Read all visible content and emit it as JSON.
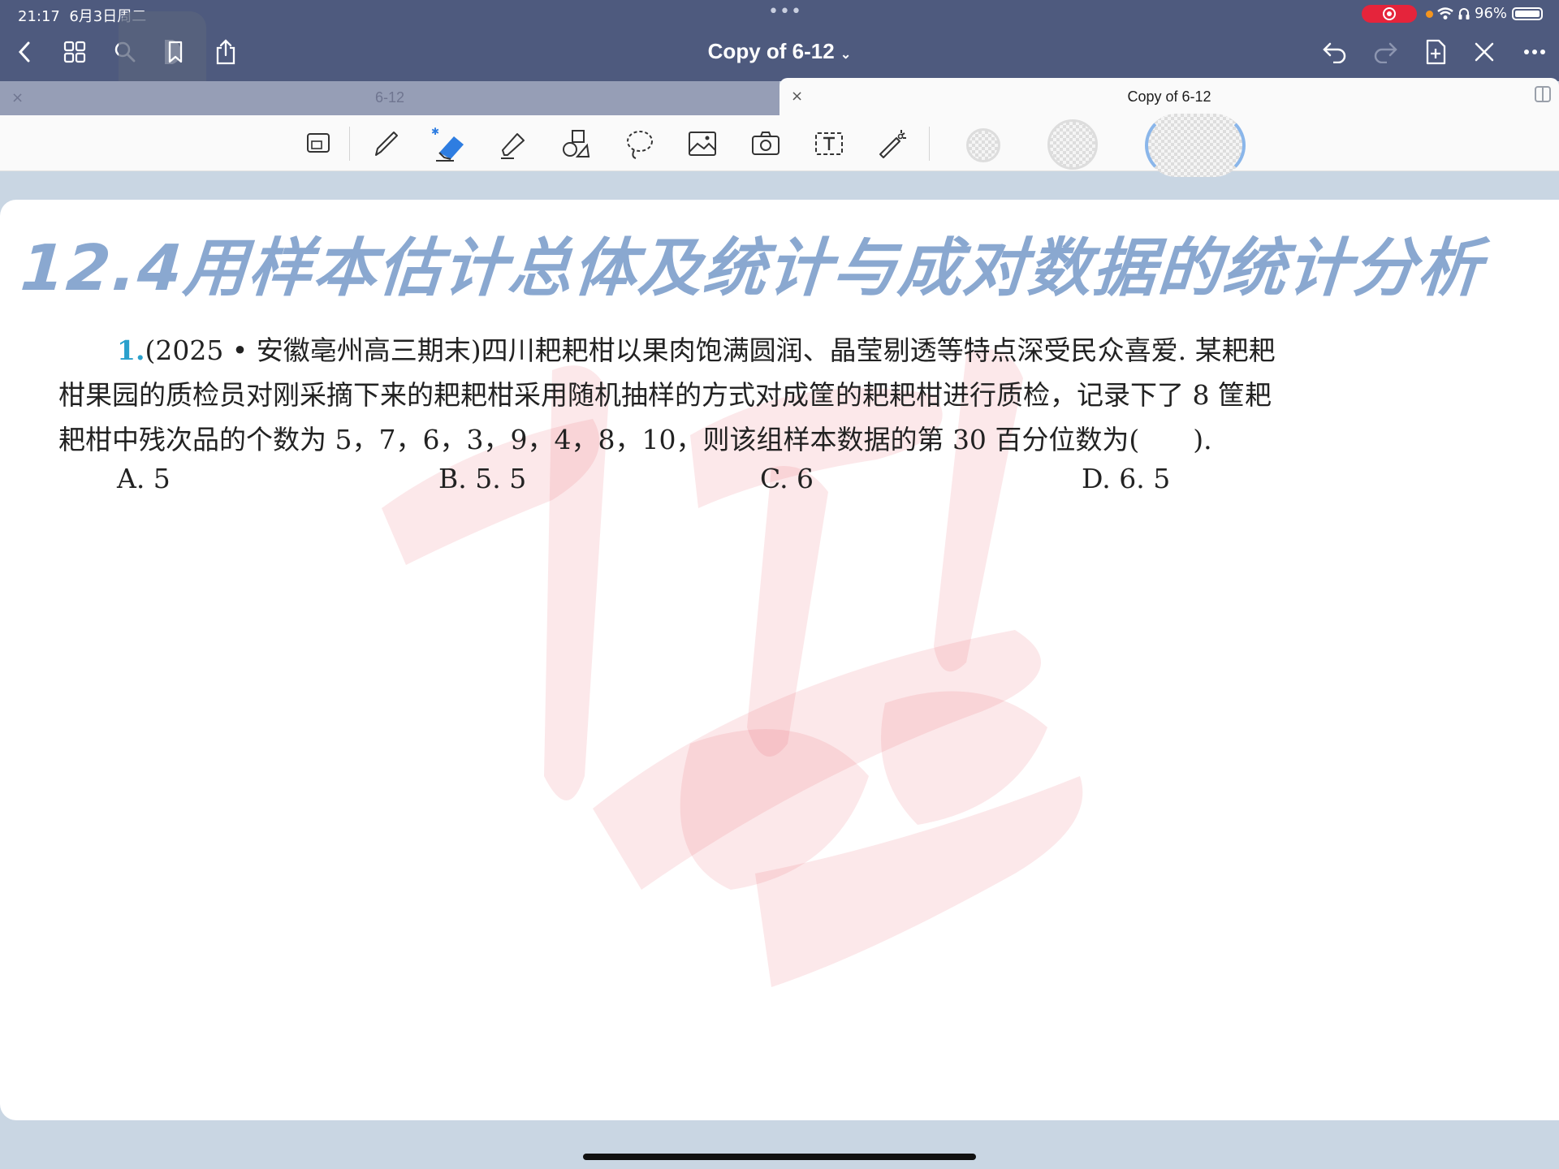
{
  "status_bar": {
    "time": "21:17",
    "date": "6月3日周二",
    "battery": "96%"
  },
  "header": {
    "title": "Copy of 6-12"
  },
  "tabs": [
    {
      "label": "6-12",
      "active": false
    },
    {
      "label": "Copy of 6-12",
      "active": true
    }
  ],
  "toolbar": {
    "tools": [
      "zoom-window",
      "pen",
      "eraser",
      "highlighter",
      "shapes",
      "lasso",
      "image",
      "camera",
      "text",
      "laser-pointer"
    ],
    "accent": "#2e7de1"
  },
  "page": {
    "heading": "12.4用样本估计总体及统计与成对数据的统计分析",
    "question": {
      "number": "1.",
      "line1": "(2025 • 安徽亳州高三期末)四川耙耙柑以果肉饱满圆润、晶莹剔透等特点深受民众喜爱. 某耙耙",
      "line2": "柑果园的质检员对刚采摘下来的耙耙柑采用随机抽样的方式对成筐的耙耙柑进行质检，记录下了 8 筐耙",
      "line3": "耙柑中残次品的个数为 5，7，6，3，9，4，8，10，则该组样本数据的第 30 百分位数为(　　)."
    },
    "options": {
      "a": "A.  5",
      "b": "B.  5. 5",
      "c": "C.  6",
      "d": "D.  6. 5"
    }
  }
}
